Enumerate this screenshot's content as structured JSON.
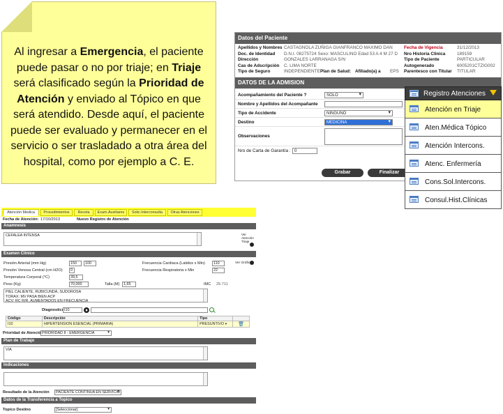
{
  "note": {
    "p1": "Al ingresar a ",
    "b1": "Emergencia",
    "p2": ", el paciente puede pasar o no por triaje; en ",
    "b2": "Triaje",
    "p3": " será clasificado según la ",
    "b3": "Prioridad de Atención",
    "p4": " y enviado al Tópico en que será atendido. Desde aquí, el paciente puede ser evaluado y permanecer en el servicio o ser trasladado a otra área del hospital, como por ejemplo a C. E."
  },
  "patient": {
    "header": "Datos del Paciente",
    "rows": [
      {
        "l1": "Apellidos y Nombres",
        "v1": "CASTAGNOLA ZUÑIGA GIANFRANCO MAXIMO DAN",
        "l2": "Fecha de Vigencia",
        "v2": "31/12/2013"
      },
      {
        "l1": "Doc. de Identidad",
        "v1": "D.N.I. 08275724   Sexo: MASCULINO  Edad 53 A 4 M 27 D",
        "l2": "Nro Historia Clinica",
        "v2": "189159"
      },
      {
        "l1": "Dirección",
        "v1": "GONZALES LARRANAGA S/N",
        "l2": "Tipo de Paciente",
        "v2": "PARTICULAR"
      },
      {
        "l1": "Cas de Adscripción",
        "v1": "C. LIMA NORTE",
        "l2": "Autogenerado",
        "v2": "6005201CTZIG002"
      },
      {
        "l1": "Tipo de Seguro",
        "v1": "INDEPENDIENTE",
        "l1b": "Plan de Salud:",
        "l1c": "Afiliado(a) a",
        "v1c": "EPS",
        "l2": "Parentesco con Titular",
        "v2": "TITULAR"
      }
    ]
  },
  "admission": {
    "header": "DATOS DE LA ADMISION",
    "acompanamiento_label": "Acompañamiento del Paciente ?",
    "acompanamiento_value": "SOLO",
    "nombre_acomp_label": "Nombre y Apellidos del Acompañante",
    "tipo_accidente_label": "Tipo de Accidente",
    "tipo_accidente_value": "NINGUNO",
    "destino_label": "Destino",
    "destino_value": "MEDICINA",
    "observaciones_label": "Observaciones",
    "nro_carta_label": "Nro de Carta de Garantía :",
    "nro_carta_value": "0",
    "grabar": "Grabar",
    "finalizar": "Finalizar"
  },
  "menu": {
    "title": "Registro Atenciones",
    "items": [
      "Atención en Triaje",
      "Aten.Médica Tópico",
      "Atención Intercons.",
      "Atenc. Enfermería",
      "Cons.Sol.Intercons.",
      "Consul.Hist.Clínicas"
    ],
    "active_index": 0,
    "highlight_color": "#ffff99"
  },
  "form": {
    "tabs": [
      "Atención Medica",
      "Procedimientos",
      "Receta",
      "Exam.Auxiliares",
      "Solic.Interconsulta",
      "Otras Atenciones"
    ],
    "fecha_label": "Fecha de Atención:",
    "fecha_value": "17/10/2013",
    "nuevo_registro": "Nuevo Registro de Atención",
    "anamnesis_header": "Anamnesis",
    "anamnesis_text": "CEFALEA INTENSA",
    "ver_atencion_triaje": "Ver Atención Triaje",
    "examen_header": "Examen Clínico",
    "presion_arterial_label": "Presión Arterial (mm Hg)",
    "presion_arterial_1": "150",
    "presion_arterial_2": "100",
    "presion_venosa_label": "Presión Venosa Central (cm H2O)",
    "presion_venosa_value": "0",
    "temperatura_label": "Temperatura Corporal (°C)",
    "temperatura_value": "39,5",
    "peso_label": "Peso (Kg)",
    "peso_value": "70,000",
    "talla_label": "Talla (M)",
    "talla_value": "1,65",
    "imc_label": "IMC",
    "imc_value": "25.711",
    "frec_cardiaca_label": "Frecuencia Cardiaca (Latidos x Min)",
    "frec_cardiaca_value": "110",
    "frec_respiratoria_label": "Frecuencia Respiratoria x Min",
    "frec_respiratoria_value": "22",
    "ver_grafico": "Ver Gráfico",
    "examen_text_1": "PIEL CALIENTE, RUBICUNDA, SUDOROSA",
    "examen_text_2": "TORAX: MV PASA BIEN ACP",
    "examen_text_3": "ACV: RC R/R, AUMENTADOS EN FRECUENCIA",
    "diagnostico_label": "Diagnostico",
    "diagnostico_value": "I10",
    "dx_columns": [
      "Código",
      "Descripción",
      "Tipo"
    ],
    "dx_rows": [
      {
        "codigo": "I10",
        "descripcion": "HIPERTENSION ESENCIAL (PRIMARIA)",
        "tipo": "PRESUNTIVO"
      }
    ],
    "prioridad_label": "Prioridad de Atención",
    "prioridad_value": "PRIORIDAD II - EMERGENCIA",
    "plan_header": "Plan de Trabajo",
    "plan_text": "VIA",
    "indicaciones_header": "Indicaciones",
    "resultado_label": "Resultado de la Atención",
    "resultado_value": "PACIENTE CONTINUA EN SERVICIO",
    "transferencia_header": "Datos de la Transferencia a Topico",
    "topico_label": "Topico Destino",
    "topico_value": "[Seleccionar]"
  }
}
